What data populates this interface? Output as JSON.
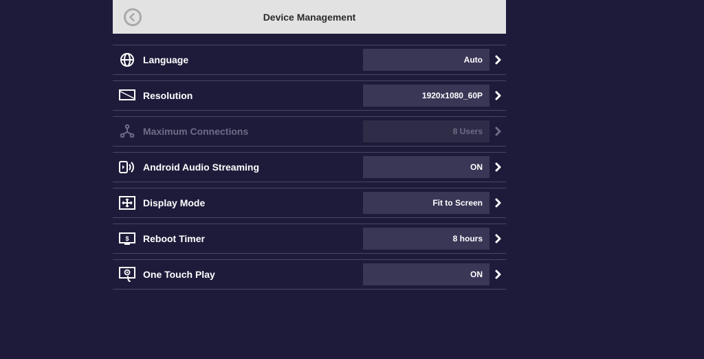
{
  "header": {
    "title": "Device Management"
  },
  "rows": [
    {
      "key": "language",
      "label": "Language",
      "value": "Auto",
      "disabled": false,
      "icon": "globe-icon"
    },
    {
      "key": "resolution",
      "label": "Resolution",
      "value": "1920x1080_60P",
      "disabled": false,
      "icon": "monitor-icon"
    },
    {
      "key": "max-connections",
      "label": "Maximum Connections",
      "value": "8 Users",
      "disabled": true,
      "icon": "connections-icon"
    },
    {
      "key": "audio-streaming",
      "label": "Android Audio Streaming",
      "value": "ON",
      "disabled": false,
      "icon": "audio-icon"
    },
    {
      "key": "display-mode",
      "label": "Display Mode",
      "value": "Fit to Screen",
      "disabled": false,
      "icon": "display-mode-icon"
    },
    {
      "key": "reboot-timer",
      "label": "Reboot Timer",
      "value": "8 hours",
      "disabled": false,
      "icon": "reboot-timer-icon"
    },
    {
      "key": "one-touch-play",
      "label": "One Touch Play",
      "value": "ON",
      "disabled": false,
      "icon": "one-touch-play-icon"
    }
  ]
}
